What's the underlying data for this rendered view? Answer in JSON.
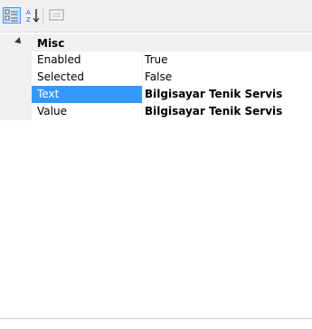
{
  "toolbar": {
    "categorized_icon": "categorized-icon",
    "alphabetical_icon": "alphabetical-icon",
    "property_pages_icon": "property-pages-icon"
  },
  "grid": {
    "category": {
      "label": "Misc",
      "expanded": true
    },
    "rows": [
      {
        "name": "Enabled",
        "value": "True"
      },
      {
        "name": "Selected",
        "value": "False"
      },
      {
        "name": "Text",
        "value": "Bilgisayar Tenik Servis",
        "selected": true
      },
      {
        "name": "Value",
        "value": "Bilgisayar Tenik Servis"
      }
    ]
  },
  "colors": {
    "selection": "#3399ff",
    "margin": "#f0f0f0"
  }
}
